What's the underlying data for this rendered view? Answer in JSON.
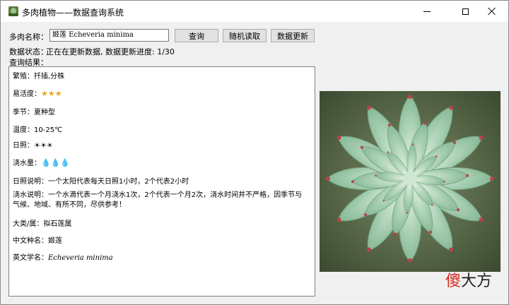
{
  "window": {
    "title": "多肉植物——数据查询系统"
  },
  "form": {
    "name_label": "多肉名称：",
    "name_value": "姬莲 Echeveria minima",
    "query_button": "查询",
    "random_button": "随机读取",
    "update_button": "数据更新",
    "status_label": "数据状态：",
    "status_value": "正在在更新数据, 数据更新进度: 1/30",
    "result_label": "查询结果："
  },
  "result": {
    "propagation": "繁殖：扦插,分株",
    "ease_label": "易活度：",
    "ease_stars": "★★★",
    "season": "季节：夏种型",
    "temperature": "温度：10-25℃",
    "sunlight_label": "日照：",
    "sunlight_value": "☀☀☀",
    "water_label": "浇水量：",
    "water_value": "💧💧💧",
    "sunlight_note": "日照说明：一个太阳代表每天日照1小时，2个代表2小时",
    "water_note": "浇水说明：一个水滴代表一个月浇水1次，2个代表一个月2次，浇水时间并不严格，因季节与气候、地域、有所不同，尽供参考！",
    "genus": "大类/属：拟石莲属",
    "cn_name_label": "中文种名：",
    "cn_name": "姬莲",
    "en_name_label": "英文学名：",
    "en_name": "Echeveria minima"
  },
  "watermark": {
    "part1": "傻",
    "part2": "大方"
  },
  "colors": {
    "star": "#e6a817",
    "drop": "#2a8fd6",
    "watermark_red": "#d62a1e"
  }
}
